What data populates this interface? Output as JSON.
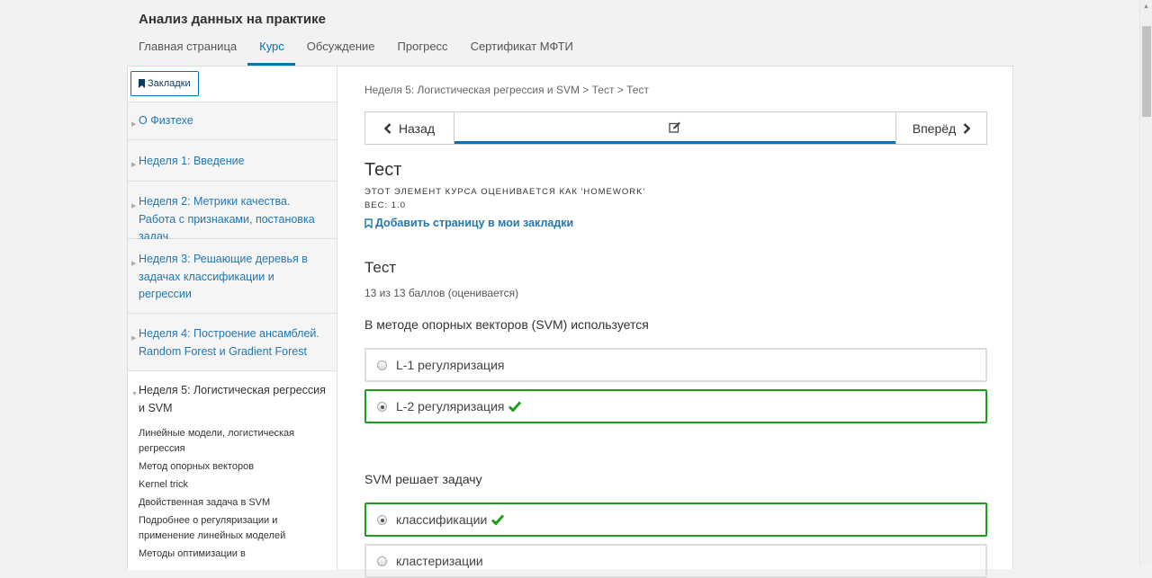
{
  "course": {
    "title": "Анализ данных на практике"
  },
  "tabs": [
    {
      "label": "Главная страница",
      "active": false
    },
    {
      "label": "Курс",
      "active": true
    },
    {
      "label": "Обсуждение",
      "active": false
    },
    {
      "label": "Прогресс",
      "active": false
    },
    {
      "label": "Сертификат МФТИ",
      "active": false
    }
  ],
  "sidebar": {
    "bookmarks_label": "Закладки",
    "chapters": [
      {
        "label": "О Физтехе"
      },
      {
        "label": "Неделя 1: Введение"
      },
      {
        "label": "Неделя 2: Метрики качества. Работа с признаками, постановка задач"
      },
      {
        "label": "Неделя 3: Решающие деревья в задачах классификации и регрессии"
      },
      {
        "label": "Неделя 4: Построение ансамблей. Random Forest и Gradient Forest"
      }
    ],
    "current_chapter": {
      "label": "Неделя 5: Логистическая регрессия и SVM",
      "subsections": [
        "Линейные модели, логистическая регрессия",
        "Метод опорных векторов",
        "Kernel trick",
        "Двойственная задача в SVM",
        "Подробнее о регуляризации и применение линейных моделей",
        "Методы оптимизации в"
      ]
    }
  },
  "main": {
    "breadcrumb": "Неделя 5: Логистическая регрессия и SVM > Тест > Тест",
    "nav": {
      "prev_label": "Назад",
      "next_label": "Вперёд",
      "current_icon": "edit-icon"
    },
    "unit_title": "Тест",
    "graded_note": "Этот элемент курса оценивается как 'Homework'",
    "weight_note": "Вес: 1.0",
    "add_bookmark_label": "Добавить страницу в мои закладки",
    "problem": {
      "title": "Тест",
      "score": "13 из 13 баллов (оценивается)",
      "questions": [
        {
          "text": "В методе опорных векторов (SVM) используется",
          "options": [
            {
              "label": "L-1 регуляризация",
              "selected": false,
              "correct": false
            },
            {
              "label": "L-2 регуляризация",
              "selected": true,
              "correct": true
            }
          ]
        },
        {
          "text": "SVM решает задачу",
          "options": [
            {
              "label": "классификации",
              "selected": true,
              "correct": true
            },
            {
              "label": "кластеризации",
              "selected": false,
              "correct": false
            }
          ]
        }
      ]
    }
  },
  "colors": {
    "accent": "#0075b4",
    "link": "#2277b3",
    "correct": "#1d9e1d"
  }
}
